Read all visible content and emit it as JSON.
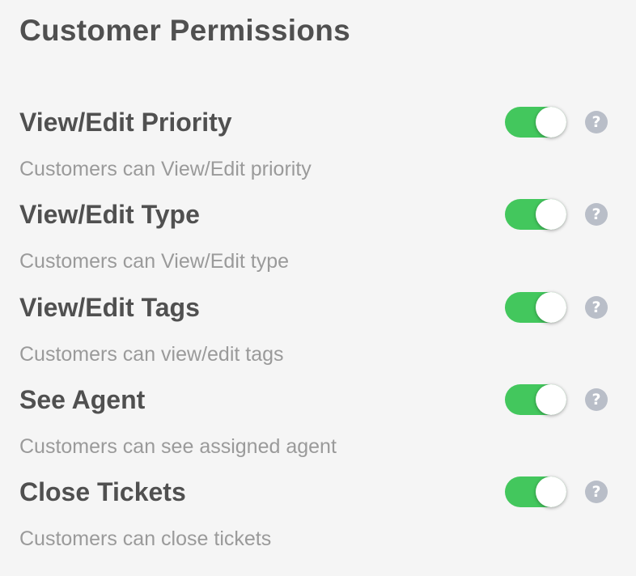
{
  "page": {
    "title": "Customer Permissions"
  },
  "permissions": [
    {
      "title": "View/Edit Priority",
      "description": "Customers can View/Edit priority",
      "enabled": true
    },
    {
      "title": "View/Edit Type",
      "description": "Customers can View/Edit type",
      "enabled": true
    },
    {
      "title": "View/Edit Tags",
      "description": "Customers can view/edit tags",
      "enabled": true
    },
    {
      "title": "See Agent",
      "description": "Customers can see assigned agent",
      "enabled": true
    },
    {
      "title": "Close Tickets",
      "description": "Customers can close tickets",
      "enabled": true
    }
  ],
  "icons": {
    "help_glyph": "?"
  },
  "colors": {
    "toggle_on": "#43c75d",
    "help_icon": "#b9bec8",
    "heading_text": "#505050",
    "description_text": "#9a9a9a"
  }
}
